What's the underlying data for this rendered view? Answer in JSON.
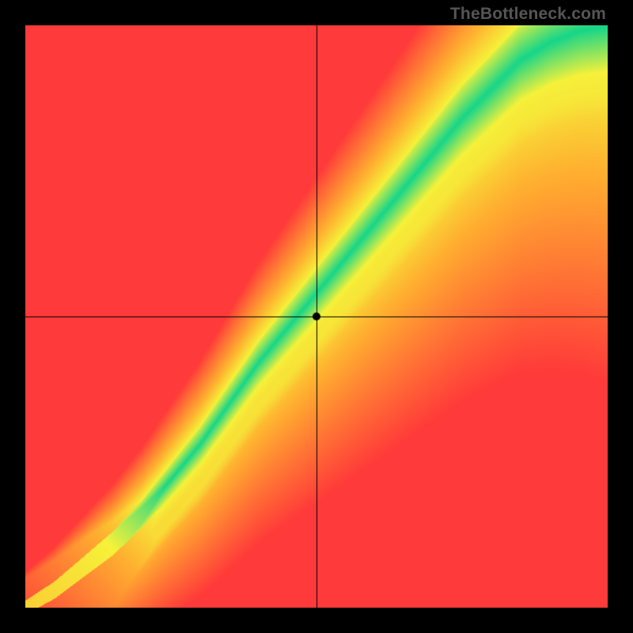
{
  "watermark": "TheBottleneck.com",
  "chart_data": {
    "type": "heatmap",
    "title": "",
    "xlabel": "",
    "ylabel": "",
    "xlim": [
      0,
      1
    ],
    "ylim": [
      0,
      1
    ],
    "crosshair": {
      "x": 0.5,
      "y": 0.5
    },
    "marker": {
      "x": 0.5,
      "y": 0.5
    },
    "ridge": {
      "description": "Optimal-ratio ridge (green) running roughly along a superlinear diagonal; color encodes distance from this ridge.",
      "curve_points_xy": [
        [
          0.0,
          0.0
        ],
        [
          0.05,
          0.03
        ],
        [
          0.1,
          0.07
        ],
        [
          0.15,
          0.11
        ],
        [
          0.2,
          0.16
        ],
        [
          0.25,
          0.22
        ],
        [
          0.3,
          0.28
        ],
        [
          0.35,
          0.35
        ],
        [
          0.4,
          0.42
        ],
        [
          0.45,
          0.48
        ],
        [
          0.5,
          0.54
        ],
        [
          0.55,
          0.6
        ],
        [
          0.6,
          0.66
        ],
        [
          0.65,
          0.72
        ],
        [
          0.7,
          0.78
        ],
        [
          0.75,
          0.84
        ],
        [
          0.8,
          0.89
        ],
        [
          0.85,
          0.94
        ],
        [
          0.9,
          0.97
        ],
        [
          0.95,
          0.99
        ],
        [
          1.0,
          1.0
        ]
      ],
      "secondary_band_below": true
    },
    "color_stops": {
      "ridge_core": "#16d68a",
      "near_ridge": "#f6f23a",
      "mid": "#ffb030",
      "far": "#ff3a3a"
    },
    "grid": false,
    "legend": null
  }
}
